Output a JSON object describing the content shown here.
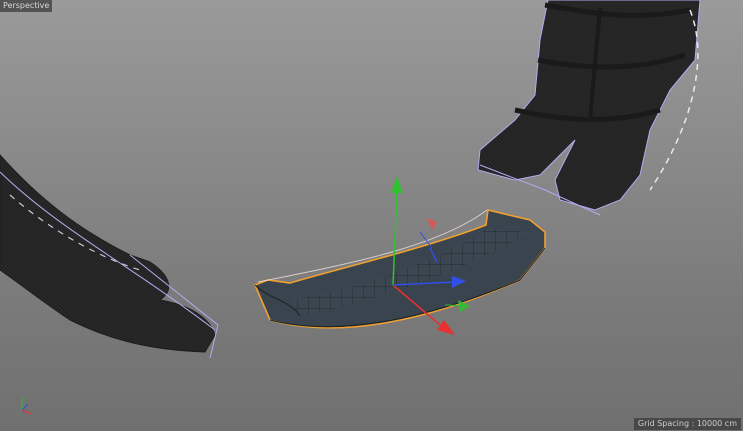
{
  "viewport": {
    "view_name": "Perspective",
    "grid_spacing_label": "Grid Spacing : 10000 cm"
  },
  "colors": {
    "background_top": "#9a9a9a",
    "background_bottom": "#707070",
    "mesh_dark": "#222222",
    "selection_outline": "#f0a030",
    "bounding_box": "#b8a8f0",
    "axis_x": "#e83030",
    "axis_y": "#30c030",
    "axis_z": "#3050e8"
  },
  "icons": {
    "axis_gizmo": "move-axis-gizmo-icon",
    "world_axis": "world-axis-indicator-icon"
  }
}
